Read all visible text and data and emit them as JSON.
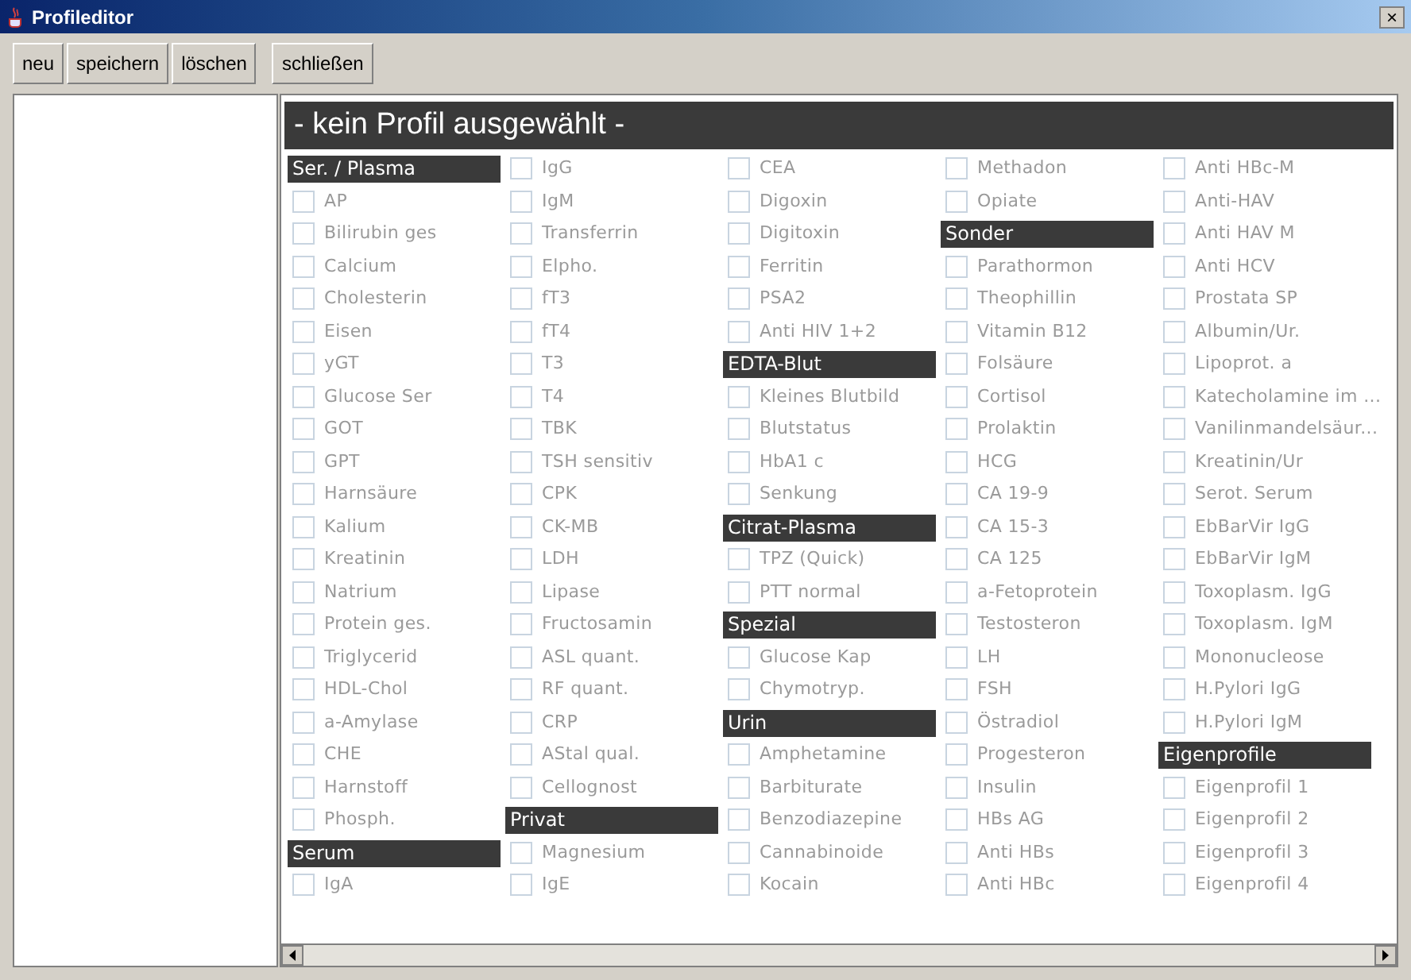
{
  "window": {
    "title": "Profileditor",
    "close": "×"
  },
  "toolbar": {
    "buttons": [
      {
        "label": "neu"
      },
      {
        "label": "speichern"
      },
      {
        "label": "löschen"
      },
      {
        "label": "schließen"
      }
    ]
  },
  "profile_header": "- kein Profil ausgewählt -",
  "columns": [
    [
      {
        "kind": "header",
        "label": "Ser. / Plasma"
      },
      {
        "kind": "checkbox",
        "label": "AP",
        "checked": false
      },
      {
        "kind": "checkbox",
        "label": "Bilirubin ges",
        "checked": false
      },
      {
        "kind": "checkbox",
        "label": "Calcium",
        "checked": false
      },
      {
        "kind": "checkbox",
        "label": "Cholesterin",
        "checked": false
      },
      {
        "kind": "checkbox",
        "label": "Eisen",
        "checked": false
      },
      {
        "kind": "checkbox",
        "label": "yGT",
        "checked": false
      },
      {
        "kind": "checkbox",
        "label": "Glucose Ser",
        "checked": false
      },
      {
        "kind": "checkbox",
        "label": "GOT",
        "checked": false
      },
      {
        "kind": "checkbox",
        "label": "GPT",
        "checked": false
      },
      {
        "kind": "checkbox",
        "label": "Harnsäure",
        "checked": false
      },
      {
        "kind": "checkbox",
        "label": "Kalium",
        "checked": false
      },
      {
        "kind": "checkbox",
        "label": "Kreatinin",
        "checked": false
      },
      {
        "kind": "checkbox",
        "label": "Natrium",
        "checked": false
      },
      {
        "kind": "checkbox",
        "label": "Protein ges.",
        "checked": false
      },
      {
        "kind": "checkbox",
        "label": "Triglycerid",
        "checked": false
      },
      {
        "kind": "checkbox",
        "label": "HDL-Chol",
        "checked": false
      },
      {
        "kind": "checkbox",
        "label": "a-Amylase",
        "checked": false
      },
      {
        "kind": "checkbox",
        "label": "CHE",
        "checked": false
      },
      {
        "kind": "checkbox",
        "label": "Harnstoff",
        "checked": false
      },
      {
        "kind": "checkbox",
        "label": "Phosph.",
        "checked": false
      },
      {
        "kind": "header",
        "label": "Serum"
      },
      {
        "kind": "checkbox",
        "label": "IgA",
        "checked": false
      }
    ],
    [
      {
        "kind": "checkbox",
        "label": "IgG",
        "checked": false
      },
      {
        "kind": "checkbox",
        "label": "IgM",
        "checked": false
      },
      {
        "kind": "checkbox",
        "label": "Transferrin",
        "checked": false
      },
      {
        "kind": "checkbox",
        "label": "Elpho.",
        "checked": false
      },
      {
        "kind": "checkbox",
        "label": "fT3",
        "checked": false
      },
      {
        "kind": "checkbox",
        "label": "fT4",
        "checked": false
      },
      {
        "kind": "checkbox",
        "label": "T3",
        "checked": false
      },
      {
        "kind": "checkbox",
        "label": "T4",
        "checked": false
      },
      {
        "kind": "checkbox",
        "label": "TBK",
        "checked": false
      },
      {
        "kind": "checkbox",
        "label": "TSH sensitiv",
        "checked": false
      },
      {
        "kind": "checkbox",
        "label": "CPK",
        "checked": false
      },
      {
        "kind": "checkbox",
        "label": "CK-MB",
        "checked": false
      },
      {
        "kind": "checkbox",
        "label": "LDH",
        "checked": false
      },
      {
        "kind": "checkbox",
        "label": "Lipase",
        "checked": false
      },
      {
        "kind": "checkbox",
        "label": "Fructosamin",
        "checked": false
      },
      {
        "kind": "checkbox",
        "label": "ASL quant.",
        "checked": false
      },
      {
        "kind": "checkbox",
        "label": "RF quant.",
        "checked": false
      },
      {
        "kind": "checkbox",
        "label": "CRP",
        "checked": false
      },
      {
        "kind": "checkbox",
        "label": "AStal qual.",
        "checked": false
      },
      {
        "kind": "checkbox",
        "label": "Cellognost",
        "checked": false
      },
      {
        "kind": "header",
        "label": "Privat"
      },
      {
        "kind": "checkbox",
        "label": "Magnesium",
        "checked": false
      },
      {
        "kind": "checkbox",
        "label": "IgE",
        "checked": false
      }
    ],
    [
      {
        "kind": "checkbox",
        "label": "CEA",
        "checked": false
      },
      {
        "kind": "checkbox",
        "label": "Digoxin",
        "checked": false
      },
      {
        "kind": "checkbox",
        "label": "Digitoxin",
        "checked": false
      },
      {
        "kind": "checkbox",
        "label": "Ferritin",
        "checked": false
      },
      {
        "kind": "checkbox",
        "label": "PSA2",
        "checked": false
      },
      {
        "kind": "checkbox",
        "label": "Anti HIV 1+2",
        "checked": false
      },
      {
        "kind": "header",
        "label": "EDTA-Blut"
      },
      {
        "kind": "checkbox",
        "label": "Kleines Blutbild",
        "checked": false
      },
      {
        "kind": "checkbox",
        "label": "Blutstatus",
        "checked": false
      },
      {
        "kind": "checkbox",
        "label": "HbA1 c",
        "checked": false
      },
      {
        "kind": "checkbox",
        "label": "Senkung",
        "checked": false
      },
      {
        "kind": "header",
        "label": "Citrat-Plasma"
      },
      {
        "kind": "checkbox",
        "label": "TPZ (Quick)",
        "checked": false
      },
      {
        "kind": "checkbox",
        "label": "PTT normal",
        "checked": false
      },
      {
        "kind": "header",
        "label": "Spezial"
      },
      {
        "kind": "checkbox",
        "label": "Glucose Kap",
        "checked": false
      },
      {
        "kind": "checkbox",
        "label": "Chymotryp.",
        "checked": false
      },
      {
        "kind": "header",
        "label": "Urin"
      },
      {
        "kind": "checkbox",
        "label": "Amphetamine",
        "checked": false
      },
      {
        "kind": "checkbox",
        "label": "Barbiturate",
        "checked": false
      },
      {
        "kind": "checkbox",
        "label": "Benzodiazepine",
        "checked": false
      },
      {
        "kind": "checkbox",
        "label": "Cannabinoide",
        "checked": false
      },
      {
        "kind": "checkbox",
        "label": "Kocain",
        "checked": false
      }
    ],
    [
      {
        "kind": "checkbox",
        "label": "Methadon",
        "checked": false
      },
      {
        "kind": "checkbox",
        "label": "Opiate",
        "checked": false
      },
      {
        "kind": "header",
        "label": "Sonder"
      },
      {
        "kind": "checkbox",
        "label": "Parathormon",
        "checked": false
      },
      {
        "kind": "checkbox",
        "label": "Theophillin",
        "checked": false
      },
      {
        "kind": "checkbox",
        "label": "Vitamin B12",
        "checked": false
      },
      {
        "kind": "checkbox",
        "label": "Folsäure",
        "checked": false
      },
      {
        "kind": "checkbox",
        "label": "Cortisol",
        "checked": false
      },
      {
        "kind": "checkbox",
        "label": "Prolaktin",
        "checked": false
      },
      {
        "kind": "checkbox",
        "label": "HCG",
        "checked": false
      },
      {
        "kind": "checkbox",
        "label": "CA 19-9",
        "checked": false
      },
      {
        "kind": "checkbox",
        "label": "CA 15-3",
        "checked": false
      },
      {
        "kind": "checkbox",
        "label": "CA 125",
        "checked": false
      },
      {
        "kind": "checkbox",
        "label": "a-Fetoprotein",
        "checked": false
      },
      {
        "kind": "checkbox",
        "label": "Testosteron",
        "checked": false
      },
      {
        "kind": "checkbox",
        "label": "LH",
        "checked": false
      },
      {
        "kind": "checkbox",
        "label": "FSH",
        "checked": false
      },
      {
        "kind": "checkbox",
        "label": "Östradiol",
        "checked": false
      },
      {
        "kind": "checkbox",
        "label": "Progesteron",
        "checked": false
      },
      {
        "kind": "checkbox",
        "label": "Insulin",
        "checked": false
      },
      {
        "kind": "checkbox",
        "label": "HBs AG",
        "checked": false
      },
      {
        "kind": "checkbox",
        "label": "Anti HBs",
        "checked": false
      },
      {
        "kind": "checkbox",
        "label": "Anti HBc",
        "checked": false
      }
    ],
    [
      {
        "kind": "checkbox",
        "label": "Anti HBc-M",
        "checked": false
      },
      {
        "kind": "checkbox",
        "label": "Anti-HAV",
        "checked": false
      },
      {
        "kind": "checkbox",
        "label": "Anti HAV M",
        "checked": false
      },
      {
        "kind": "checkbox",
        "label": "Anti HCV",
        "checked": false
      },
      {
        "kind": "checkbox",
        "label": "Prostata SP",
        "checked": false
      },
      {
        "kind": "checkbox",
        "label": "Albumin/Ur.",
        "checked": false
      },
      {
        "kind": "checkbox",
        "label": "Lipoprot. a",
        "checked": false
      },
      {
        "kind": "checkbox",
        "label": "Katecholamine im ...",
        "checked": false
      },
      {
        "kind": "checkbox",
        "label": "Vanilinmandelsäur...",
        "checked": false
      },
      {
        "kind": "checkbox",
        "label": "Kreatinin/Ur",
        "checked": false
      },
      {
        "kind": "checkbox",
        "label": "Serot. Serum",
        "checked": false
      },
      {
        "kind": "checkbox",
        "label": "EbBarVir IgG",
        "checked": false
      },
      {
        "kind": "checkbox",
        "label": "EbBarVir IgM",
        "checked": false
      },
      {
        "kind": "checkbox",
        "label": "Toxoplasm. IgG",
        "checked": false
      },
      {
        "kind": "checkbox",
        "label": "Toxoplasm. IgM",
        "checked": false
      },
      {
        "kind": "checkbox",
        "label": "Mononucleose",
        "checked": false
      },
      {
        "kind": "checkbox",
        "label": "H.Pylori IgG",
        "checked": false
      },
      {
        "kind": "checkbox",
        "label": "H.Pylori IgM",
        "checked": false
      },
      {
        "kind": "header",
        "label": "Eigenprofile"
      },
      {
        "kind": "checkbox",
        "label": "Eigenprofil 1",
        "checked": false
      },
      {
        "kind": "checkbox",
        "label": "Eigenprofil 2",
        "checked": false
      },
      {
        "kind": "checkbox",
        "label": "Eigenprofil 3",
        "checked": false
      },
      {
        "kind": "checkbox",
        "label": "Eigenprofil 4",
        "checked": false
      }
    ]
  ]
}
